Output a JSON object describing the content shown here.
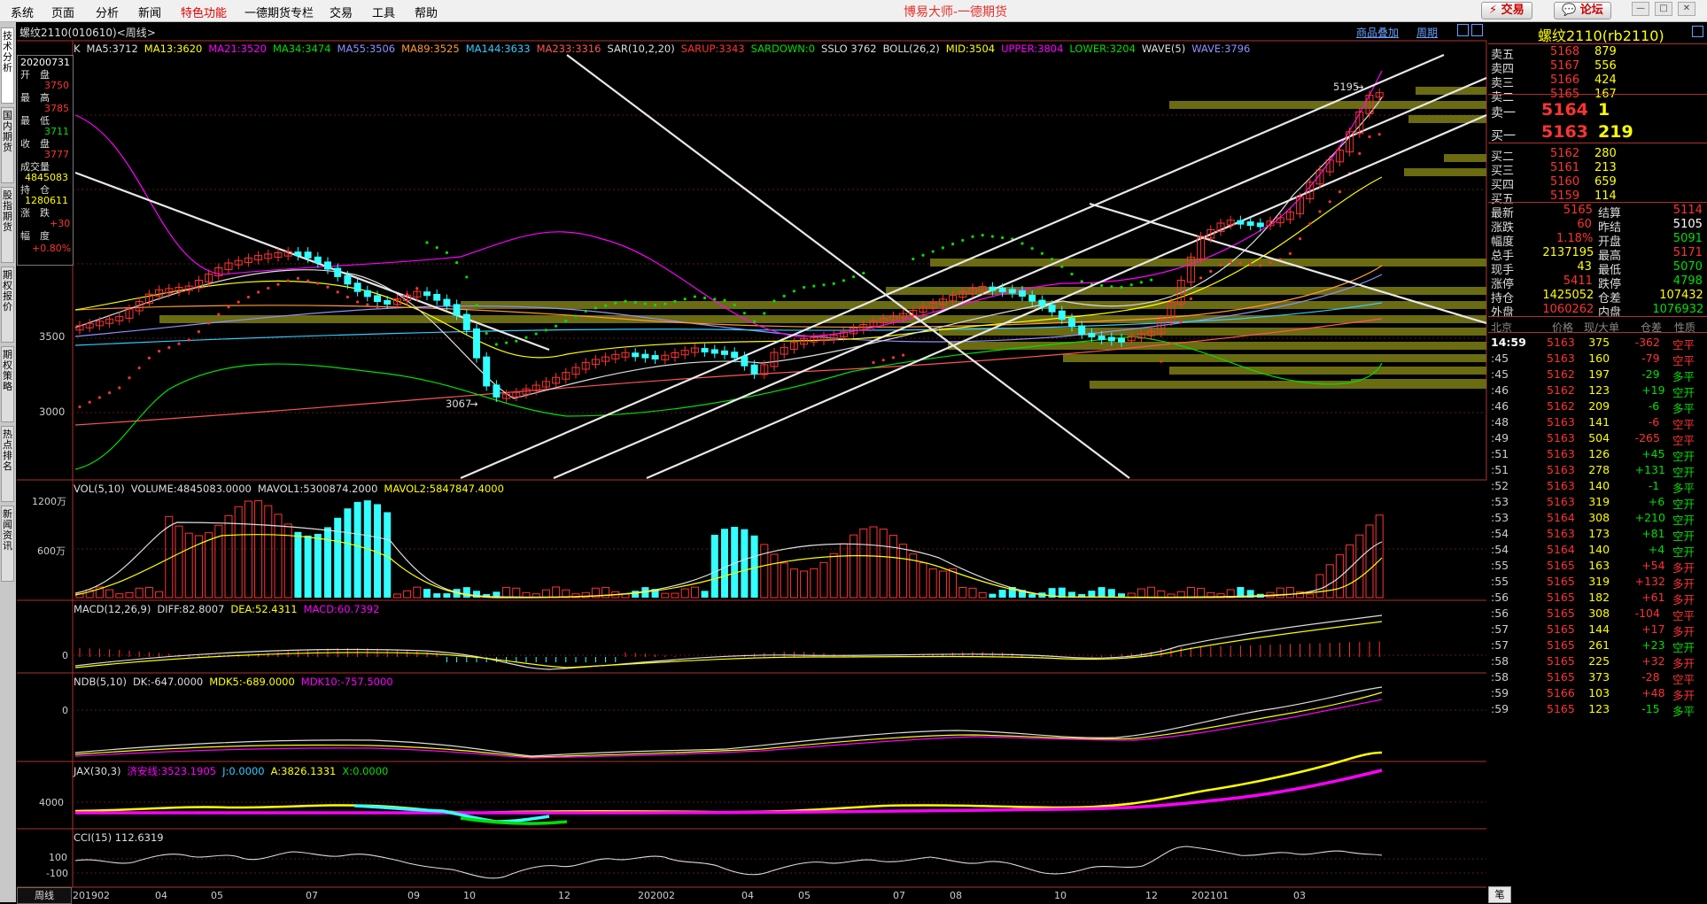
{
  "menubar": {
    "items": [
      "系统",
      "页面",
      "分析",
      "新闻",
      "特色功能",
      "一德期货专栏",
      "交易",
      "工具",
      "帮助"
    ],
    "app_title": "博易大师-一德期货",
    "trade_button": "⚡ 交易",
    "forum_button": "💬 论坛"
  },
  "left_tabs": [
    "技术分析",
    "国内期货",
    "股指期货",
    "期权报价",
    "期权策略",
    "热点排名",
    "新闻资讯"
  ],
  "chart": {
    "title": "螺纹2110(010610)<周线>",
    "overlay_link": "商品叠加",
    "period_link": "周期",
    "indicators": [
      {
        "text": "K",
        "color": "#dddddd"
      },
      {
        "text": "MA5:3712",
        "color": "#dddddd"
      },
      {
        "text": "MA13:3620",
        "color": "#ffff00"
      },
      {
        "text": "MA21:3520",
        "color": "#ff00ff"
      },
      {
        "text": "MA34:3474",
        "color": "#00e000"
      },
      {
        "text": "MA55:3506",
        "color": "#9090ff"
      },
      {
        "text": "MA89:3525",
        "color": "#ff9933"
      },
      {
        "text": "MA144:3633",
        "color": "#33ccff"
      },
      {
        "text": "MA233:3316",
        "color": "#ff5555"
      },
      {
        "text": "SAR(10,2,20)",
        "color": "#dddddd"
      },
      {
        "text": "SARUP:3343",
        "color": "#ff3333"
      },
      {
        "text": "SARDOWN:0",
        "color": "#00e000"
      },
      {
        "text": "SSLO 3762",
        "color": "#dddddd"
      },
      {
        "text": "BOLL(26,2)",
        "color": "#dddddd"
      },
      {
        "text": "MID:3504",
        "color": "#ffff00"
      },
      {
        "text": "UPPER:3804",
        "color": "#ff00ff"
      },
      {
        "text": "LOWER:3204",
        "color": "#00e000"
      },
      {
        "text": "WAVE(5)",
        "color": "#dddddd"
      },
      {
        "text": "WAVE:3796",
        "color": "#9090ff"
      }
    ],
    "price_ticks": [
      "3500",
      "3000"
    ],
    "high_mark": "5195",
    "low_mark": "3067",
    "infobox": {
      "date": "20200731",
      "open_label": "开　盘",
      "open": "3750",
      "high_label": "最　高",
      "high": "3785",
      "low_label": "最　低",
      "low": "3711",
      "close_label": "收　盘",
      "close": "3777",
      "volume_label": "成交量",
      "volume": "4845083",
      "oi_label": "持　仓",
      "oi": "1280611",
      "change_label": "涨　跌",
      "change": "+30",
      "pct_label": "幅　度",
      "pct": "+0.80%"
    },
    "vol": {
      "items": [
        {
          "text": "VOL(5,10)",
          "color": "#dddddd"
        },
        {
          "text": "VOLUME:4845083.0000",
          "color": "#dddddd"
        },
        {
          "text": "MAVOL1:5300874.2000",
          "color": "#dddddd"
        },
        {
          "text": "MAVOL2:5847847.4000",
          "color": "#ffff00"
        }
      ],
      "ticks": [
        "1200万",
        "600万"
      ]
    },
    "macd": {
      "items": [
        {
          "text": "MACD(12,26,9)",
          "color": "#dddddd"
        },
        {
          "text": "DIFF:82.8007",
          "color": "#dddddd"
        },
        {
          "text": "DEA:52.4311",
          "color": "#ffff00"
        },
        {
          "text": "MACD:60.7392",
          "color": "#ff00ff"
        }
      ],
      "tick": "0"
    },
    "ndb": {
      "items": [
        {
          "text": "NDB(5,10)",
          "color": "#dddddd"
        },
        {
          "text": "DK:-647.0000",
          "color": "#dddddd"
        },
        {
          "text": "MDK5:-689.0000",
          "color": "#ffff00"
        },
        {
          "text": "MDK10:-757.5000",
          "color": "#ff00ff"
        }
      ],
      "tick": "0"
    },
    "jax": {
      "items": [
        {
          "text": "JAX(30,3)",
          "color": "#dddddd"
        },
        {
          "text": "济安线:3523.1905",
          "color": "#ff00ff"
        },
        {
          "text": "J:0.0000",
          "color": "#33ccff"
        },
        {
          "text": "A:3826.1331",
          "color": "#ffff00"
        },
        {
          "text": "X:0.0000",
          "color": "#00e000"
        }
      ],
      "tick": "4000"
    },
    "cci": {
      "items": [
        {
          "text": "CCI(15)  112.6319",
          "color": "#dddddd"
        }
      ],
      "ticks": [
        "100",
        "-100"
      ]
    },
    "period_tab": "周线",
    "x_axis": [
      "201902",
      "04",
      "05",
      "07",
      "09",
      "10",
      "12",
      "202002",
      "04",
      "05",
      "07",
      "08",
      "10",
      "12",
      "202101",
      "03"
    ]
  },
  "quote": {
    "title": "螺纹2110(rb2110)",
    "asks": [
      {
        "label": "卖五",
        "price": "5168",
        "vol": "879"
      },
      {
        "label": "卖四",
        "price": "5167",
        "vol": "556"
      },
      {
        "label": "卖三",
        "price": "5166",
        "vol": "424"
      },
      {
        "label": "卖二",
        "price": "5165",
        "vol": "167"
      }
    ],
    "ask1": {
      "label": "卖一",
      "price": "5164",
      "vol": "1"
    },
    "bid1": {
      "label": "买一",
      "price": "5163",
      "vol": "219"
    },
    "bids": [
      {
        "label": "买二",
        "price": "5162",
        "vol": "280"
      },
      {
        "label": "买三",
        "price": "5161",
        "vol": "213"
      },
      {
        "label": "买四",
        "price": "5160",
        "vol": "659"
      },
      {
        "label": "买五",
        "price": "5159",
        "vol": "114"
      }
    ],
    "stats": [
      {
        "l1": "最新",
        "v1": "5165",
        "c1": "#ff3333",
        "l2": "结算",
        "v2": "5114",
        "c2": "#ff3333"
      },
      {
        "l1": "涨跌",
        "v1": "60",
        "c1": "#ff3333",
        "l2": "昨结",
        "v2": "5105",
        "c2": "#ffffff"
      },
      {
        "l1": "幅度",
        "v1": "1.18%",
        "c1": "#ff3333",
        "l2": "开盘",
        "v2": "5091",
        "c2": "#00e000"
      },
      {
        "l1": "总手",
        "v1": "2137195",
        "c1": "#ffff00",
        "l2": "最高",
        "v2": "5171",
        "c2": "#ff3333"
      },
      {
        "l1": "现手",
        "v1": "43",
        "c1": "#ffff00",
        "l2": "最低",
        "v2": "5070",
        "c2": "#00e000"
      },
      {
        "l1": "涨停",
        "v1": "5411",
        "c1": "#ff3333",
        "l2": "跌停",
        "v2": "4798",
        "c2": "#00e000"
      },
      {
        "l1": "持仓",
        "v1": "1425052",
        "c1": "#ffff00",
        "l2": "仓差",
        "v2": "107432",
        "c2": "#ffff00"
      },
      {
        "l1": "外盘",
        "v1": "1060262",
        "c1": "#ff3333",
        "l2": "内盘",
        "v2": "1076932",
        "c2": "#00e000"
      }
    ],
    "ticks_header": [
      "北京",
      "价格",
      "现/大单",
      "仓差",
      "性质"
    ],
    "ticks": [
      {
        "time": "14:59",
        "price": "5163",
        "pc": "#ff3333",
        "vol": "375",
        "oi": "-362",
        "oc": "#ff3333",
        "nature": "空平",
        "nc": "#ff3333"
      },
      {
        "time": ":45",
        "price": "5163",
        "pc": "#ff3333",
        "vol": "160",
        "oi": "-79",
        "oc": "#ff3333",
        "nature": "空平",
        "nc": "#ff3333"
      },
      {
        "time": ":45",
        "price": "5162",
        "pc": "#ff3333",
        "vol": "197",
        "oi": "-29",
        "oc": "#00e000",
        "nature": "多平",
        "nc": "#00e000"
      },
      {
        "time": ":46",
        "price": "5162",
        "pc": "#ff3333",
        "vol": "123",
        "oi": "+19",
        "oc": "#00e000",
        "nature": "空开",
        "nc": "#00e000"
      },
      {
        "time": ":46",
        "price": "5162",
        "pc": "#ff3333",
        "vol": "209",
        "oi": "-6",
        "oc": "#00e000",
        "nature": "多平",
        "nc": "#00e000"
      },
      {
        "time": ":48",
        "price": "5163",
        "pc": "#ff3333",
        "vol": "141",
        "oi": "-6",
        "oc": "#ff3333",
        "nature": "空平",
        "nc": "#ff3333"
      },
      {
        "time": ":49",
        "price": "5163",
        "pc": "#ff3333",
        "vol": "504",
        "oi": "-265",
        "oc": "#ff3333",
        "nature": "空平",
        "nc": "#ff3333"
      },
      {
        "time": ":51",
        "price": "5163",
        "pc": "#ff3333",
        "vol": "126",
        "oi": "+45",
        "oc": "#00e000",
        "nature": "空开",
        "nc": "#00e000"
      },
      {
        "time": ":51",
        "price": "5163",
        "pc": "#ff3333",
        "vol": "278",
        "oi": "+131",
        "oc": "#00e000",
        "nature": "空开",
        "nc": "#00e000"
      },
      {
        "time": ":52",
        "price": "5163",
        "pc": "#ff3333",
        "vol": "140",
        "oi": "-1",
        "oc": "#00e000",
        "nature": "多平",
        "nc": "#00e000"
      },
      {
        "time": ":53",
        "price": "5163",
        "pc": "#ff3333",
        "vol": "319",
        "oi": "+6",
        "oc": "#00e000",
        "nature": "空开",
        "nc": "#00e000"
      },
      {
        "time": ":53",
        "price": "5164",
        "pc": "#ff3333",
        "vol": "308",
        "oi": "+210",
        "oc": "#00e000",
        "nature": "空开",
        "nc": "#00e000"
      },
      {
        "time": ":54",
        "price": "5163",
        "pc": "#ff3333",
        "vol": "173",
        "oi": "+81",
        "oc": "#00e000",
        "nature": "空开",
        "nc": "#00e000"
      },
      {
        "time": ":54",
        "price": "5164",
        "pc": "#ff3333",
        "vol": "140",
        "oi": "+4",
        "oc": "#00e000",
        "nature": "空开",
        "nc": "#00e000"
      },
      {
        "time": ":55",
        "price": "5165",
        "pc": "#ff3333",
        "vol": "163",
        "oi": "+54",
        "oc": "#ff3333",
        "nature": "多开",
        "nc": "#ff3333"
      },
      {
        "time": ":55",
        "price": "5165",
        "pc": "#ff3333",
        "vol": "319",
        "oi": "+132",
        "oc": "#ff3333",
        "nature": "多开",
        "nc": "#ff3333"
      },
      {
        "time": ":56",
        "price": "5165",
        "pc": "#ff3333",
        "vol": "182",
        "oi": "+61",
        "oc": "#ff3333",
        "nature": "多开",
        "nc": "#ff3333"
      },
      {
        "time": ":56",
        "price": "5165",
        "pc": "#ff3333",
        "vol": "308",
        "oi": "-104",
        "oc": "#ff3333",
        "nature": "空平",
        "nc": "#ff3333"
      },
      {
        "time": ":57",
        "price": "5165",
        "pc": "#ff3333",
        "vol": "144",
        "oi": "+17",
        "oc": "#ff3333",
        "nature": "多开",
        "nc": "#ff3333"
      },
      {
        "time": ":57",
        "price": "5165",
        "pc": "#ff3333",
        "vol": "261",
        "oi": "+23",
        "oc": "#00e000",
        "nature": "空开",
        "nc": "#00e000"
      },
      {
        "time": ":58",
        "price": "5165",
        "pc": "#ff3333",
        "vol": "225",
        "oi": "+32",
        "oc": "#ff3333",
        "nature": "多开",
        "nc": "#ff3333"
      },
      {
        "time": ":58",
        "price": "5165",
        "pc": "#ff3333",
        "vol": "373",
        "oi": "-28",
        "oc": "#ff3333",
        "nature": "空平",
        "nc": "#ff3333"
      },
      {
        "time": ":59",
        "price": "5166",
        "pc": "#ff3333",
        "vol": "103",
        "oi": "+48",
        "oc": "#ff3333",
        "nature": "多开",
        "nc": "#ff3333"
      },
      {
        "time": ":59",
        "price": "5165",
        "pc": "#ff3333",
        "vol": "123",
        "oi": "-15",
        "oc": "#00e000",
        "nature": "多平",
        "nc": "#00e000"
      }
    ],
    "bottom_tab": "笔"
  }
}
